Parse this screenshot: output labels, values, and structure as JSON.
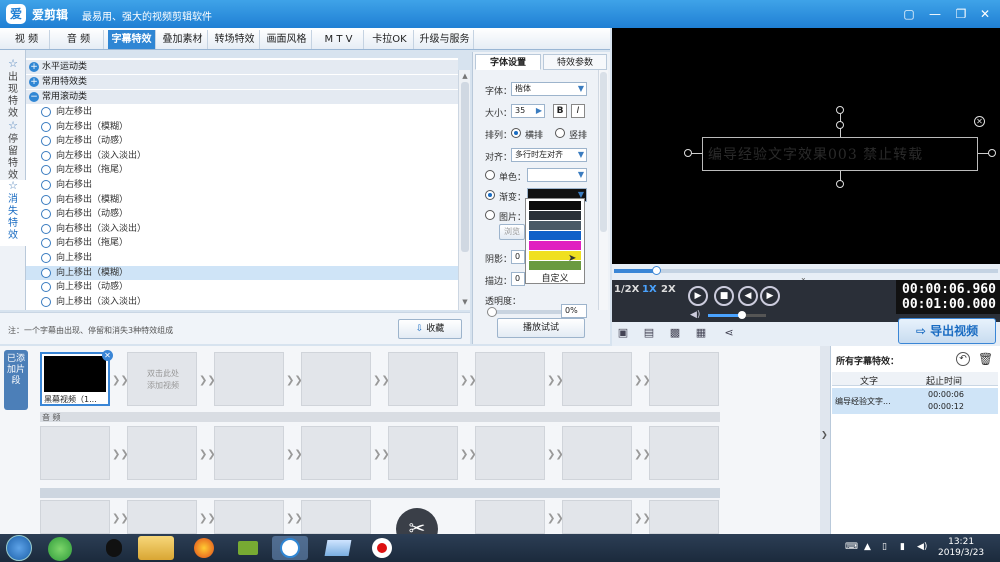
{
  "app": {
    "logo": "爱",
    "title": "爱剪辑",
    "slogan": "最易用、强大的视频剪辑软件"
  },
  "window_buttons": {
    "minimize": "—",
    "restore": "❐",
    "close": "✕"
  },
  "tabs": [
    "视 频",
    "音 频",
    "字幕特效",
    "叠加素材",
    "转场特效",
    "画面风格",
    "M T V",
    "卡拉OK",
    "升级与服务"
  ],
  "left_vtabs": [
    {
      "icon": "☆",
      "label": "出现特效"
    },
    {
      "icon": "☆",
      "label": "停留特效"
    },
    {
      "icon": "☆",
      "label": "消失特效"
    }
  ],
  "effect_list": {
    "categories": [
      {
        "icon": "+",
        "label": "水平运动类"
      },
      {
        "icon": "+",
        "label": "常用特效类"
      },
      {
        "icon": "−",
        "label": "常用滚动类"
      }
    ],
    "items": [
      "向左移出",
      "向左移出（模糊）",
      "向左移出（动感）",
      "向左移出（淡入淡出）",
      "向左移出（拖尾）",
      "向右移出",
      "向右移出（模糊）",
      "向右移出（动感）",
      "向右移出（淡入淡出）",
      "向右移出（拖尾）",
      "向上移出",
      "向上移出（模糊）",
      "向上移出（动感）",
      "向上移出（淡入淡出）"
    ],
    "selected_item": "向上移出（模糊）"
  },
  "note": {
    "text": "注：一个字幕由出现、停留和消失3种特效组成",
    "collect_label": "收藏",
    "play_test_label": "播放试试"
  },
  "settings": {
    "tab_font": "字体设置",
    "tab_effect": "特效参数",
    "font_label": "字体：",
    "font_value": "楷体",
    "size_label": "大小：",
    "size_value": "35",
    "bold": "B",
    "italic": "I",
    "arrange_label": "排列：",
    "arrange_horizontal": "横排",
    "arrange_vertical": "竖排",
    "align_label": "对齐：",
    "align_value": "多行时左对齐",
    "single_color_label": "单色：",
    "gradient_label": "渐变：",
    "image_label": "图片：",
    "browse_label": "浏览",
    "shadow_label": "阴影：",
    "shadow_value": "0",
    "stroke_label": "描边：",
    "stroke_value": "0",
    "opacity_label": "透明度：",
    "opacity_value": "0%"
  },
  "gradient_popup": {
    "swatches": [
      "#0c0c0c",
      "#2a3138",
      "#4a5a66",
      "#1060c8",
      "#e020c0",
      "#f0e020",
      "#6a9a40"
    ],
    "custom_label": "自定义"
  },
  "preview": {
    "text": "编导经验文字效果003  禁止转载",
    "progress": 0.11,
    "time_current": "00:00:06.960",
    "time_total": "00:01:00.000",
    "speeds": [
      "1/2X",
      "1X",
      "2X"
    ],
    "volume": 0.58
  },
  "toolbar2": {
    "icons": [
      "new-project-icon",
      "open-folder-icon",
      "save-icon",
      "save-as-icon",
      "share-icon"
    ],
    "export_label": "导出视频"
  },
  "timeline": {
    "track_label": "已添加片段",
    "clip_name": "黑幕视频（1...",
    "add_hint": "双击此处\n添加视频",
    "audio_label": "音 频"
  },
  "right_panel": {
    "title": "所有字幕特效：",
    "col_text": "文字",
    "col_time": "起止时间",
    "row_text": "编导经验文字...",
    "row_start": "00:00:06",
    "row_end": "00:00:12"
  },
  "taskbar": {
    "time": "13:21",
    "date": "2019/3/23"
  },
  "colors": {
    "accent": "#2f86d4",
    "selected_row": "#cfe4f7",
    "preview_bg": "#000000"
  }
}
